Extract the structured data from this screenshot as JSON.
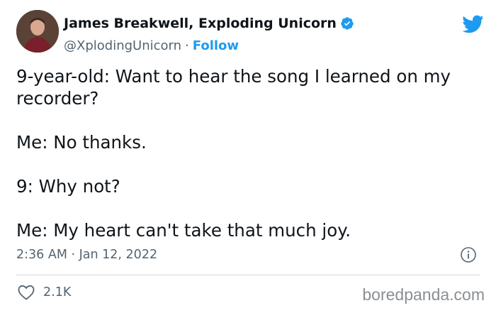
{
  "author": {
    "display_name": "James Breakwell, Exploding Unicorn",
    "handle": "@XplodingUnicorn",
    "separator": "·",
    "follow_label": "Follow",
    "avatar_icon": "profile-photo",
    "verified_icon": "verified-badge-icon"
  },
  "brand": {
    "logo_icon": "twitter-bird-icon",
    "color": "#1d9bf0"
  },
  "tweet": {
    "lines": [
      "9-year-old: Want to hear the song I learned on my recorder?",
      "Me: No thanks.",
      "9: Why not?",
      "Me: My heart can't take that much joy."
    ],
    "timestamp": "2:36 AM · Jan 12, 2022"
  },
  "engagement": {
    "likes": "2.1K",
    "like_icon": "heart-icon",
    "info_icon": "info-icon"
  },
  "watermark": "boredpanda.com",
  "colors": {
    "text": "#0f1419",
    "muted": "#536471",
    "divider": "#cfd9de",
    "accent": "#1d9bf0"
  }
}
